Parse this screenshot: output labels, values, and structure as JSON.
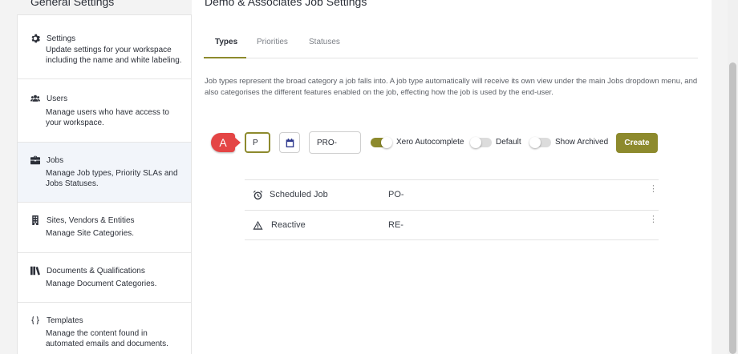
{
  "sidebar": {
    "title": "General Settings",
    "items": [
      {
        "icon": "gear-icon",
        "label": "Settings",
        "description": "Update settings for your workspace including the name and white labeling."
      },
      {
        "icon": "users-icon",
        "label": "Users",
        "description": "Manage users who have access to your workspace."
      },
      {
        "icon": "briefcase-icon",
        "label": "Jobs",
        "description": "Manage Job types, Priority SLAs and Jobs Statuses."
      },
      {
        "icon": "building-icon",
        "label": "Sites, Vendors & Entities",
        "description": "Manage Site Categories."
      },
      {
        "icon": "books-icon",
        "label": "Documents & Qualifications",
        "description": "Manage Document Categories."
      },
      {
        "icon": "braces-icon",
        "label": "Templates",
        "description": "Manage the content found in automated emails and documents."
      }
    ],
    "active_index": 2
  },
  "main": {
    "title": "Demo & Associates Job Settings",
    "tabs": [
      {
        "label": "Types"
      },
      {
        "label": "Priorities"
      },
      {
        "label": "Statuses"
      }
    ],
    "description": "Job types represent the broad category a job falls into. A job type automatically will receive its own view under the main Jobs dropdown menu, and also categorises the different features enabled on the job, effecting how the job is used by the end-user."
  },
  "toolbar": {
    "annotation_badge": "A",
    "abbreviation_value": "P",
    "prefix_value": "PRO-",
    "xero_label": "Xero Autocomplete",
    "xero_on": true,
    "default_label": "Default",
    "default_on": false,
    "archived_label": "Show Archived",
    "archived_on": false,
    "create_label": "Create"
  },
  "job_types": [
    {
      "icon": "alarm-clock-icon",
      "name": "Scheduled Job",
      "prefix": "PO-"
    },
    {
      "icon": "warning-triangle-icon",
      "name": "Reactive",
      "prefix": "RE-"
    }
  ],
  "colors": {
    "accent": "#8d8a2d",
    "badge": "#e44545",
    "calendar_icon": "#2f3a8f",
    "active_sidebar": "#f2f5fa"
  }
}
